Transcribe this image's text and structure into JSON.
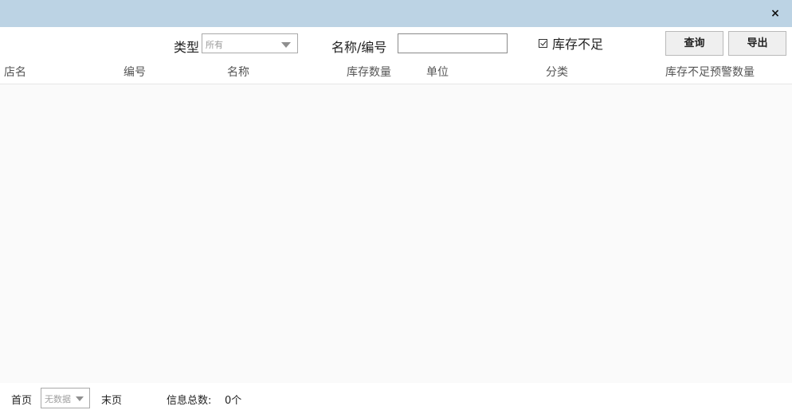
{
  "window": {
    "close_symbol": "×"
  },
  "filters": {
    "type_label": "类型",
    "type_selected": "所有",
    "name_label": "名称/编号",
    "name_value": "",
    "low_stock_label": "库存不足",
    "low_stock_checked": true
  },
  "buttons": {
    "query": "查询",
    "export": "导出"
  },
  "table": {
    "columns": [
      "店名",
      "编号",
      "名称",
      "库存数量",
      "单位",
      "分类",
      "库存不足预警数量"
    ],
    "rows": []
  },
  "pager": {
    "first_page": "首页",
    "page_select_value": "无数据",
    "last_page": "末页",
    "total_label": "信息总数:",
    "total_value": "0个"
  },
  "colors": {
    "titlebar": "#bcd3e4",
    "table_body": "#fafafa",
    "button_bg": "#efefef"
  }
}
